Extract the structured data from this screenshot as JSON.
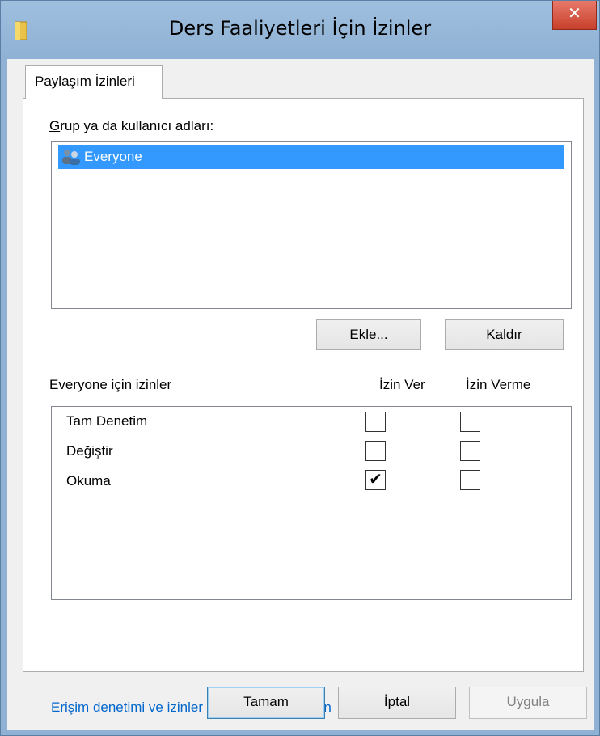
{
  "window": {
    "title": "Ders Faaliyetleri İçin İzinler",
    "close_glyph": "✕"
  },
  "tabs": [
    {
      "label": "Paylaşım İzinleri",
      "selected": true
    }
  ],
  "users_section": {
    "label": "Grup ya da kullanıcı adları:",
    "users": [
      {
        "name": "Everyone",
        "icon": "users-group-icon",
        "selected": true
      }
    ],
    "add_button": "Ekle...",
    "remove_button": "Kaldır"
  },
  "permissions": {
    "header": "Everyone için izinler",
    "allow_header": "İzin Ver",
    "deny_header": "İzin Verme",
    "rows": [
      {
        "name": "Tam Denetim",
        "allow": false,
        "deny": false
      },
      {
        "name": "Değiştir",
        "allow": false,
        "deny": false
      },
      {
        "name": "Okuma",
        "allow": true,
        "deny": false
      }
    ],
    "check_glyph": "✔"
  },
  "help_link": "Erişim denetimi ve izinler hakkında bilgi edinin",
  "footer": {
    "ok": "Tamam",
    "cancel": "İptal",
    "apply": "Uygula"
  },
  "colors": {
    "selection": "#3399ff",
    "link": "#0066cc",
    "frame": "#8fb1d3",
    "close": "#c7402b"
  }
}
